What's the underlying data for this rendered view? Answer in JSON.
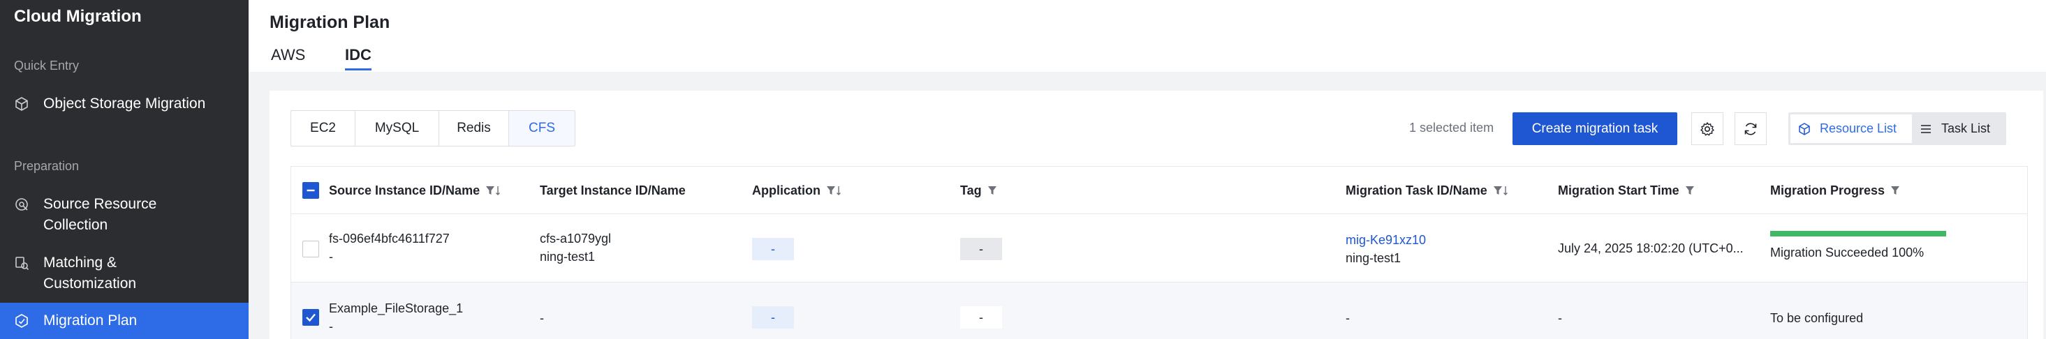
{
  "app_title": "Cloud Migration",
  "sidebar": {
    "sections": [
      {
        "label": "Quick Entry"
      },
      {
        "label": "Preparation"
      }
    ],
    "items": [
      {
        "label": "Object Storage Migration",
        "icon": "cube-icon",
        "active": false
      },
      {
        "label": "Source Resource Collection",
        "icon": "scan-icon",
        "active": false
      },
      {
        "label": "Matching & Customization",
        "icon": "match-icon",
        "active": false
      },
      {
        "label": "Migration Plan",
        "icon": "hexagon-plan-icon",
        "active": true
      }
    ]
  },
  "header": {
    "title": "Migration Plan",
    "tabs": [
      {
        "label": "AWS",
        "active": false
      },
      {
        "label": "IDC",
        "active": true
      }
    ]
  },
  "toolbar": {
    "resource_types": [
      {
        "label": "EC2",
        "selected": false
      },
      {
        "label": "MySQL",
        "selected": false
      },
      {
        "label": "Redis",
        "selected": false
      },
      {
        "label": "CFS",
        "selected": true
      }
    ],
    "selected_count": "1 selected item",
    "create_label": "Create migration task",
    "views": [
      {
        "label": "Resource List",
        "active": true
      },
      {
        "label": "Task List",
        "active": false
      }
    ]
  },
  "table": {
    "columns": [
      "Source Instance ID/Name",
      "Target Instance ID/Name",
      "Application",
      "Tag",
      "Migration Task ID/Name",
      "Migration Start Time",
      "Migration Progress"
    ],
    "rows": [
      {
        "checked": false,
        "source_id": "fs-096ef4bfc4611f727",
        "source_name": "-",
        "target_id": "cfs-a1079ygl",
        "target_name": "ning-test1",
        "application": "-",
        "tag": "-",
        "task_id": "mig-Ke91xz10",
        "task_name": "ning-test1",
        "start_time": "July 24, 2025 18:02:20 (UTC+0...",
        "progress_text": "Migration Succeeded 100%",
        "progress": 1.0
      },
      {
        "checked": true,
        "source_id": "Example_FileStorage_1",
        "source_name": "-",
        "target_id": "-",
        "target_name": "",
        "application": "-",
        "tag": "-",
        "task_id": "-",
        "task_name": "",
        "start_time": "-",
        "progress_text": "To be configured",
        "progress": null
      }
    ]
  },
  "colors": {
    "sidebar_bg": "#2b2d31",
    "accent": "#1f56d1",
    "success": "#3fb866"
  }
}
